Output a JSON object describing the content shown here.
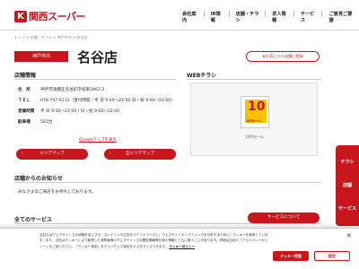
{
  "header": {
    "logo_mark": "K",
    "logo_text": "関西スーパー",
    "nav": [
      "会社案内",
      "IR情報",
      "店舗・チラシ",
      "求人情報",
      "サービス",
      "ご意見ご要望"
    ]
  },
  "breadcrumb": "トップ > 店舗・チラシ > 神戸市内 > 名谷店",
  "store": {
    "area_badge": "神戸市内",
    "name": "名谷店",
    "favorite_button": "★お気に入り店舗に登録"
  },
  "info": {
    "heading": "店舗情報",
    "rows": [
      {
        "key": "住　所",
        "value": "神戸市須磨区名谷町字宿南3467-2"
      },
      {
        "key": "ＴＥＬ",
        "value": "078-797-6112（受付時間／平 日 9:00〜22:00 日・祝 9:00〜22:00）"
      },
      {
        "key": "営業時間",
        "value": "平 日 9:00〜22:00 / 日・祝 9:00〜22:00"
      },
      {
        "key": "駐車場",
        "value": "581台"
      }
    ],
    "google_map_link": "Googleマップを表示",
    "area_map_button": "エリアマップ",
    "all_area_map_button": "全エリアマップ"
  },
  "flyer": {
    "heading": "WEBチラシ",
    "image_number": "10",
    "image_text": "10円セール",
    "caption": "10円セール"
  },
  "notice": {
    "heading": "店舗からのお知らせ",
    "text": "みなさまのご来店をお待ちしております。"
  },
  "services": {
    "heading": "全てのサービス",
    "button": "サービスについて"
  },
  "side_tabs": [
    "チラシ",
    "店舗",
    "サービス"
  ],
  "cookie": {
    "text": "当社ではウェブサイトでの体験を向上させ、コンテンツや広告をパーソナライズし、ウェブサイトのトラフィックを分析するために、クッキーを使用しています。また、当社はクッキーにより取得した消費者様のウェブサイトでの閲覧情報等を個人情報とともに扱うことがあります。詳細は当社の「プライバシーポリシー」をご覧ください。「クッキー設定」をクリックして設定をカスタマイズできます。",
    "link": "クッキーポリシー",
    "accept_button": "クッキー受容",
    "settings_button": "設定",
    "close": "✕"
  },
  "colors": {
    "brand_red": "#c8161d"
  }
}
